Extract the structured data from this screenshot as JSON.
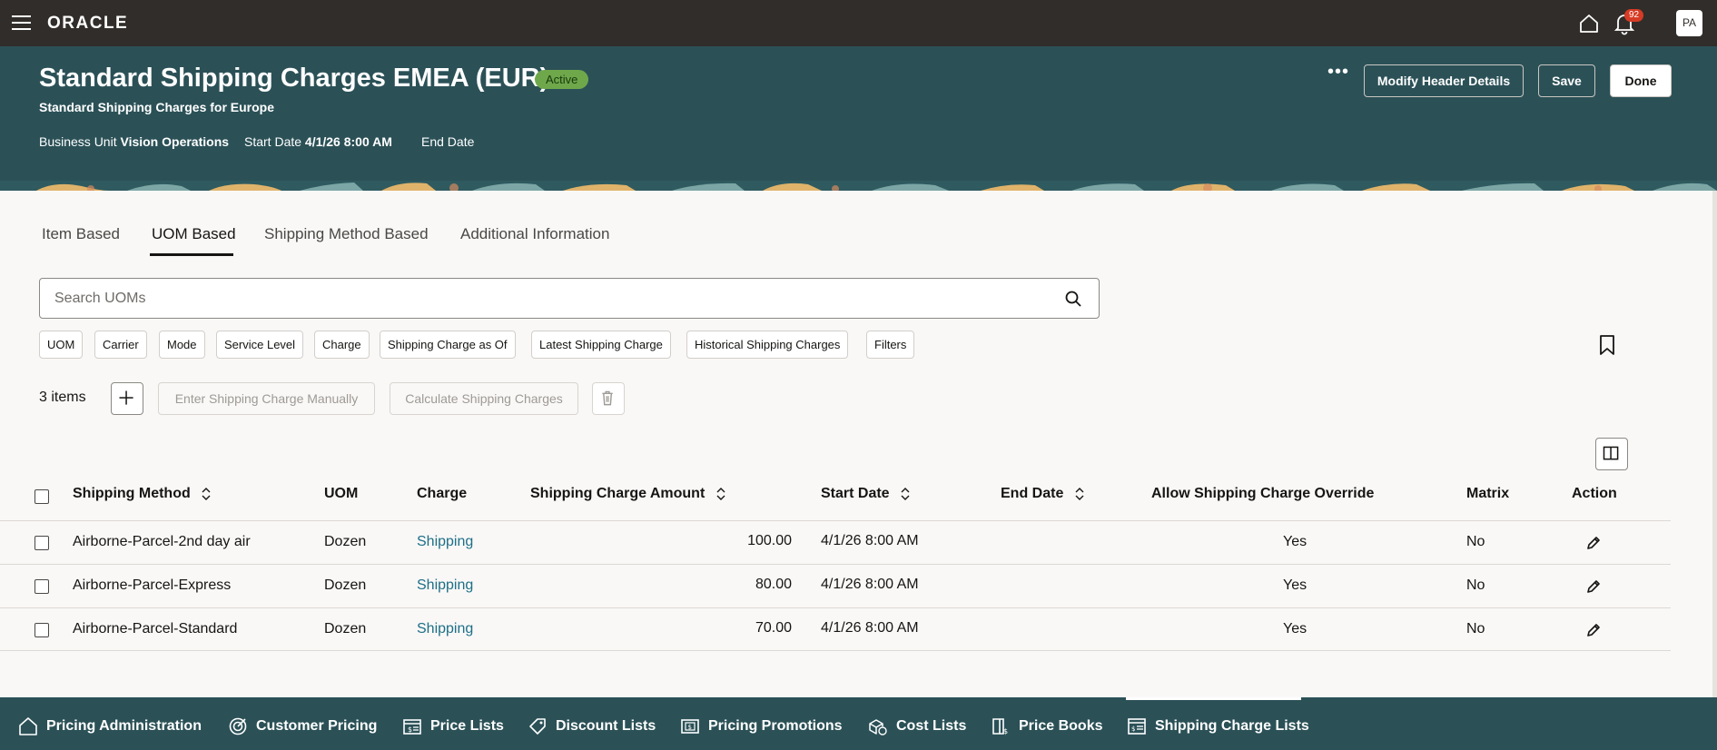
{
  "topbar": {
    "logo": "ORACLE",
    "notification_count": "92",
    "avatar_initials": "PA"
  },
  "header": {
    "title": "Standard Shipping Charges EMEA (EUR)",
    "status": "Active",
    "subtitle": "Standard Shipping Charges for Europe",
    "business_unit_label": "Business Unit",
    "business_unit_value": "Vision Operations",
    "start_date_label": "Start Date",
    "start_date_value": "4/1/26 8:00 AM",
    "end_date_label": "End Date",
    "more_actions": "•••",
    "modify_header_label": "Modify Header Details",
    "save_label": "Save",
    "done_label": "Done"
  },
  "tabs": [
    {
      "label": "Item Based",
      "active": false
    },
    {
      "label": "UOM Based",
      "active": true
    },
    {
      "label": "Shipping Method Based",
      "active": false
    },
    {
      "label": "Additional Information",
      "active": false
    }
  ],
  "search": {
    "placeholder": "Search UOMs",
    "value": ""
  },
  "filters": [
    "UOM",
    "Carrier",
    "Mode",
    "Service Level",
    "Charge",
    "Shipping Charge as Of",
    "Latest Shipping Charge",
    "Historical Shipping Charges",
    "Filters"
  ],
  "toolbar": {
    "items_count": "3 items",
    "enter_manually_label": "Enter Shipping Charge Manually",
    "calculate_label": "Calculate Shipping Charges"
  },
  "table": {
    "columns": {
      "shipping_method": "Shipping Method",
      "uom": "UOM",
      "charge": "Charge",
      "amount": "Shipping Charge Amount",
      "start_date": "Start Date",
      "end_date": "End Date",
      "override": "Allow Shipping Charge Override",
      "matrix": "Matrix",
      "action": "Action"
    },
    "rows": [
      {
        "shipping_method": "Airborne-Parcel-2nd day air",
        "uom": "Dozen",
        "charge": "Shipping",
        "amount": "100.00",
        "start_date": "4/1/26 8:00 AM",
        "end_date": "",
        "override": "Yes",
        "matrix": "No"
      },
      {
        "shipping_method": "Airborne-Parcel-Express",
        "uom": "Dozen",
        "charge": "Shipping",
        "amount": "80.00",
        "start_date": "4/1/26 8:00 AM",
        "end_date": "",
        "override": "Yes",
        "matrix": "No"
      },
      {
        "shipping_method": "Airborne-Parcel-Standard",
        "uom": "Dozen",
        "charge": "Shipping",
        "amount": "70.00",
        "start_date": "4/1/26 8:00 AM",
        "end_date": "",
        "override": "Yes",
        "matrix": "No"
      }
    ]
  },
  "bottom_nav": [
    {
      "label": "Pricing Administration",
      "icon": "home-icon"
    },
    {
      "label": "Customer Pricing",
      "icon": "target-icon"
    },
    {
      "label": "Price Lists",
      "icon": "price-list-icon"
    },
    {
      "label": "Discount Lists",
      "icon": "tag-icon"
    },
    {
      "label": "Pricing Promotions",
      "icon": "promotion-icon"
    },
    {
      "label": "Cost Lists",
      "icon": "cost-icon"
    },
    {
      "label": "Price Books",
      "icon": "book-icon"
    },
    {
      "label": "Shipping Charge Lists",
      "icon": "shipping-list-icon",
      "active": true
    }
  ],
  "colors": {
    "topbar": "#312d2a",
    "header": "#2b5157",
    "status_badge": "#6fa84b",
    "link": "#1d6f86"
  }
}
